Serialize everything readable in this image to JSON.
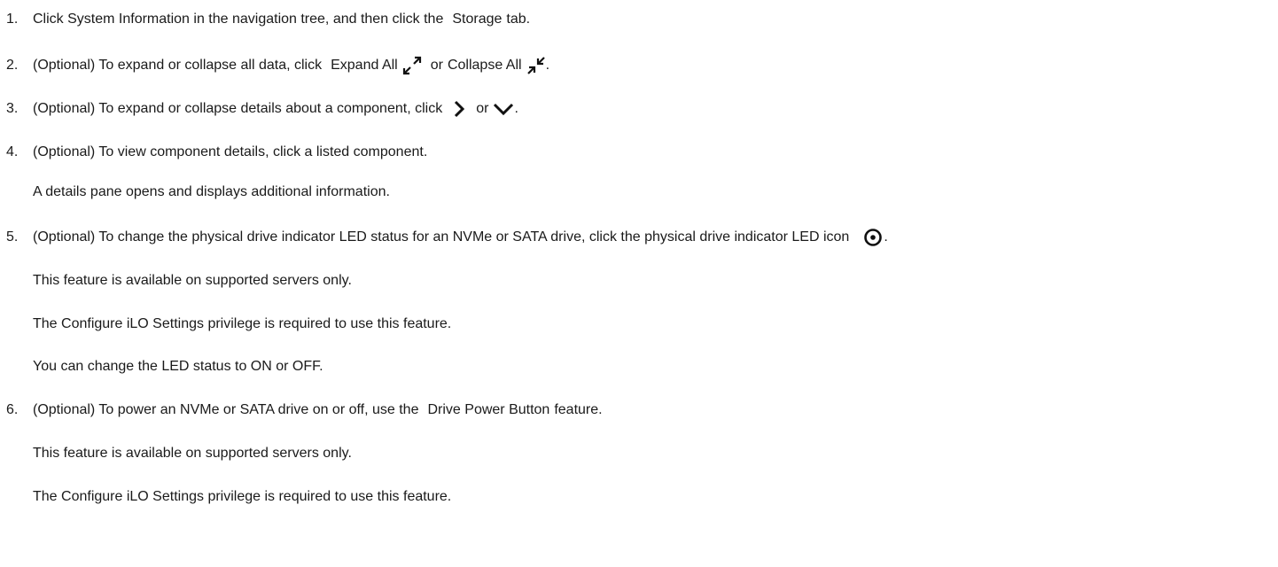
{
  "steps": [
    {
      "number": "1.",
      "a": "Click System Information in the navigation tree, and then click the",
      "ui": "Storage",
      "b": "tab."
    },
    {
      "number": "2.",
      "a": "(Optional) To expand or collapse all data, click",
      "ui1": "Expand All",
      "icon1": "expand-all-icon",
      "mid": "or",
      "ui2": "Collapse All",
      "icon2": "collapse-all-icon",
      "end": "."
    },
    {
      "number": "3.",
      "a": "(Optional) To expand or collapse details about a component, click",
      "icon1": "chevron-right-icon",
      "mid": "or",
      "icon2": "chevron-down-icon",
      "end": "."
    },
    {
      "number": "4.",
      "a": "(Optional) To view component details, click a listed component.",
      "notes": [
        "A details pane opens and displays additional information."
      ]
    },
    {
      "number": "5.",
      "a": "(Optional) To change the physical drive indicator LED status for an NVMe or SATA drive, click the physical drive indicator LED icon",
      "icon1": "led-indicator-icon",
      "end": ".",
      "notes": [
        "This feature is available on supported servers only.",
        "The Configure iLO Settings privilege is required to use this feature.",
        "You can change the LED status to ON or OFF."
      ]
    },
    {
      "number": "6.",
      "a": "(Optional) To power an NVMe or SATA drive on or off, use the",
      "ui": "Drive Power Button",
      "b": "feature.",
      "notes": [
        "This feature is available on supported servers only.",
        "The Configure iLO Settings privilege is required to use this feature."
      ]
    }
  ]
}
